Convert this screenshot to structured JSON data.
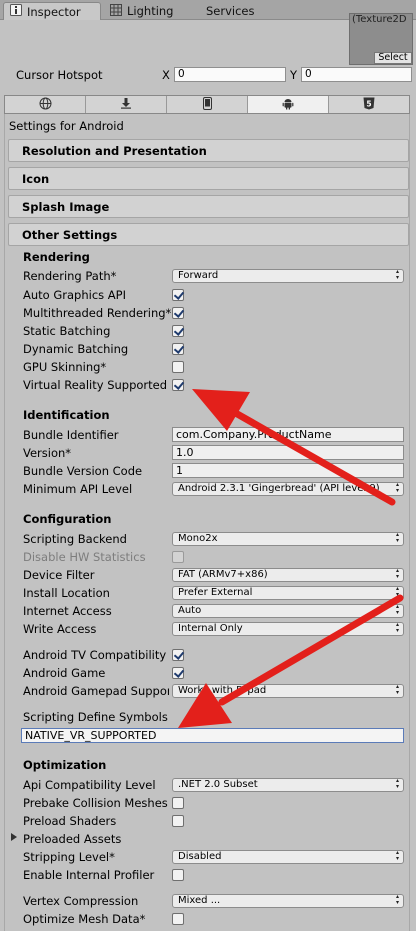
{
  "tabs": [
    {
      "label": "Inspector",
      "icon": "info-icon",
      "active": true
    },
    {
      "label": "Lighting",
      "icon": "lighting-icon",
      "active": false
    },
    {
      "label": "Services",
      "icon": "",
      "active": false
    }
  ],
  "texture": {
    "name": "(Texture2D",
    "select_label": "Select"
  },
  "cursor_hotspot": {
    "label": "Cursor Hotspot",
    "x_label": "X",
    "x": "0",
    "y_label": "Y",
    "y": "0"
  },
  "platform_tabs": [
    {
      "icon": "globe-icon",
      "selected": false
    },
    {
      "icon": "download-icon",
      "selected": false
    },
    {
      "icon": "phone-icon",
      "selected": false
    },
    {
      "icon": "android-icon",
      "selected": true
    },
    {
      "icon": "html5-icon",
      "selected": false
    }
  ],
  "settings_title": "Settings for Android",
  "sections": {
    "resolution": "Resolution and Presentation",
    "icon": "Icon",
    "splash": "Splash Image",
    "other": "Other Settings"
  },
  "rendering": {
    "title": "Rendering",
    "rendering_path": {
      "label": "Rendering Path*",
      "value": "Forward"
    },
    "auto_graphics": {
      "label": "Auto Graphics API",
      "checked": true
    },
    "multithreaded": {
      "label": "Multithreaded Rendering*",
      "checked": true
    },
    "static_batching": {
      "label": "Static Batching",
      "checked": true
    },
    "dynamic_batching": {
      "label": "Dynamic Batching",
      "checked": true
    },
    "gpu_skinning": {
      "label": "GPU Skinning*",
      "checked": false
    },
    "vr_supported": {
      "label": "Virtual Reality Supported",
      "checked": true
    }
  },
  "identification": {
    "title": "Identification",
    "bundle_identifier": {
      "label": "Bundle Identifier",
      "value": "com.Company.ProductName"
    },
    "version": {
      "label": "Version*",
      "value": "1.0"
    },
    "bundle_version_code": {
      "label": "Bundle Version Code",
      "value": "1"
    },
    "min_api": {
      "label": "Minimum API Level",
      "value": "Android 2.3.1 'Gingerbread' (API level 9)"
    }
  },
  "configuration": {
    "title": "Configuration",
    "scripting_backend": {
      "label": "Scripting Backend",
      "value": "Mono2x"
    },
    "disable_hw": {
      "label": "Disable HW Statistics",
      "checked": false
    },
    "device_filter": {
      "label": "Device Filter",
      "value": "FAT (ARMv7+x86)"
    },
    "install_location": {
      "label": "Install Location",
      "value": "Prefer External"
    },
    "internet_access": {
      "label": "Internet Access",
      "value": "Auto"
    },
    "write_access": {
      "label": "Write Access",
      "value": "Internal Only"
    },
    "android_tv": {
      "label": "Android TV Compatibility",
      "checked": true
    },
    "android_game": {
      "label": "Android Game",
      "checked": true
    },
    "gamepad": {
      "label": "Android Gamepad Support",
      "value": "Works with D-pad"
    },
    "define_symbols": {
      "label": "Scripting Define Symbols",
      "value": "NATIVE_VR_SUPPORTED"
    }
  },
  "optimization": {
    "title": "Optimization",
    "api_compat": {
      "label": "Api Compatibility Level",
      "value": ".NET 2.0 Subset"
    },
    "prebake": {
      "label": "Prebake Collision Meshes",
      "checked": false
    },
    "preload_shaders": {
      "label": "Preload Shaders",
      "checked": false
    },
    "preloaded_assets": {
      "label": "Preloaded Assets"
    },
    "stripping": {
      "label": "Stripping Level*",
      "value": "Disabled"
    },
    "internal_profiler": {
      "label": "Enable Internal Profiler",
      "checked": false
    },
    "vertex_compression": {
      "label": "Vertex Compression",
      "value": "Mixed ..."
    },
    "optimize_mesh": {
      "label": "Optimize Mesh Data*",
      "checked": false
    }
  },
  "annotation_color": "#e3201b"
}
